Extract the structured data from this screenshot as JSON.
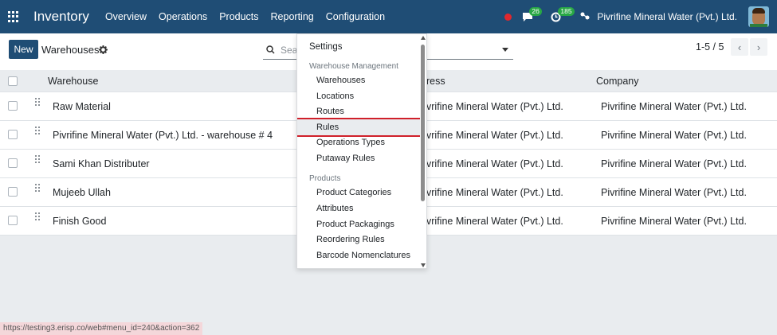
{
  "navbar": {
    "app_title": "Inventory",
    "menu": [
      "Overview",
      "Operations",
      "Products",
      "Reporting",
      "Configuration"
    ],
    "messages_count": "26",
    "activities_count": "185",
    "company": "Pivrifine Mineral Water (Pvt.) Ltd."
  },
  "control": {
    "new_label": "New",
    "breadcrumb": "Warehouses",
    "search_placeholder": "Sea",
    "pager": "1-5 / 5"
  },
  "table": {
    "headers": [
      "Warehouse",
      "ress",
      "Company"
    ],
    "rows": [
      {
        "warehouse": "Raw Material",
        "address": "vrifine Mineral Water (Pvt.) Ltd.",
        "company": "Pivrifine Mineral Water (Pvt.) Ltd."
      },
      {
        "warehouse": "Pivrifine Mineral Water (Pvt.) Ltd. - warehouse # 4",
        "address": "vrifine Mineral Water (Pvt.) Ltd.",
        "company": "Pivrifine Mineral Water (Pvt.) Ltd."
      },
      {
        "warehouse": "Sami Khan Distributer",
        "address": "vrifine Mineral Water (Pvt.) Ltd.",
        "company": "Pivrifine Mineral Water (Pvt.) Ltd."
      },
      {
        "warehouse": "Mujeeb Ullah",
        "address": "vrifine Mineral Water (Pvt.) Ltd.",
        "company": "Pivrifine Mineral Water (Pvt.) Ltd."
      },
      {
        "warehouse": "Finish Good",
        "address": "vrifine Mineral Water (Pvt.) Ltd.",
        "company": "Pivrifine Mineral Water (Pvt.) Ltd."
      }
    ]
  },
  "dropdown": {
    "settings": "Settings",
    "section_warehouse": "Warehouse Management",
    "warehouse_items": [
      "Warehouses",
      "Locations",
      "Routes",
      "Rules",
      "Operations Types",
      "Putaway Rules"
    ],
    "section_products": "Products",
    "product_items": [
      "Product Categories",
      "Attributes",
      "Product Packagings",
      "Reordering Rules",
      "Barcode Nomenclatures"
    ]
  },
  "status_url": "https://testing3.erisp.co/web#menu_id=240&action=362",
  "colors": {
    "navbar": "#1f4d75",
    "highlight_border": "#d0202a",
    "badge": "#28a745"
  }
}
